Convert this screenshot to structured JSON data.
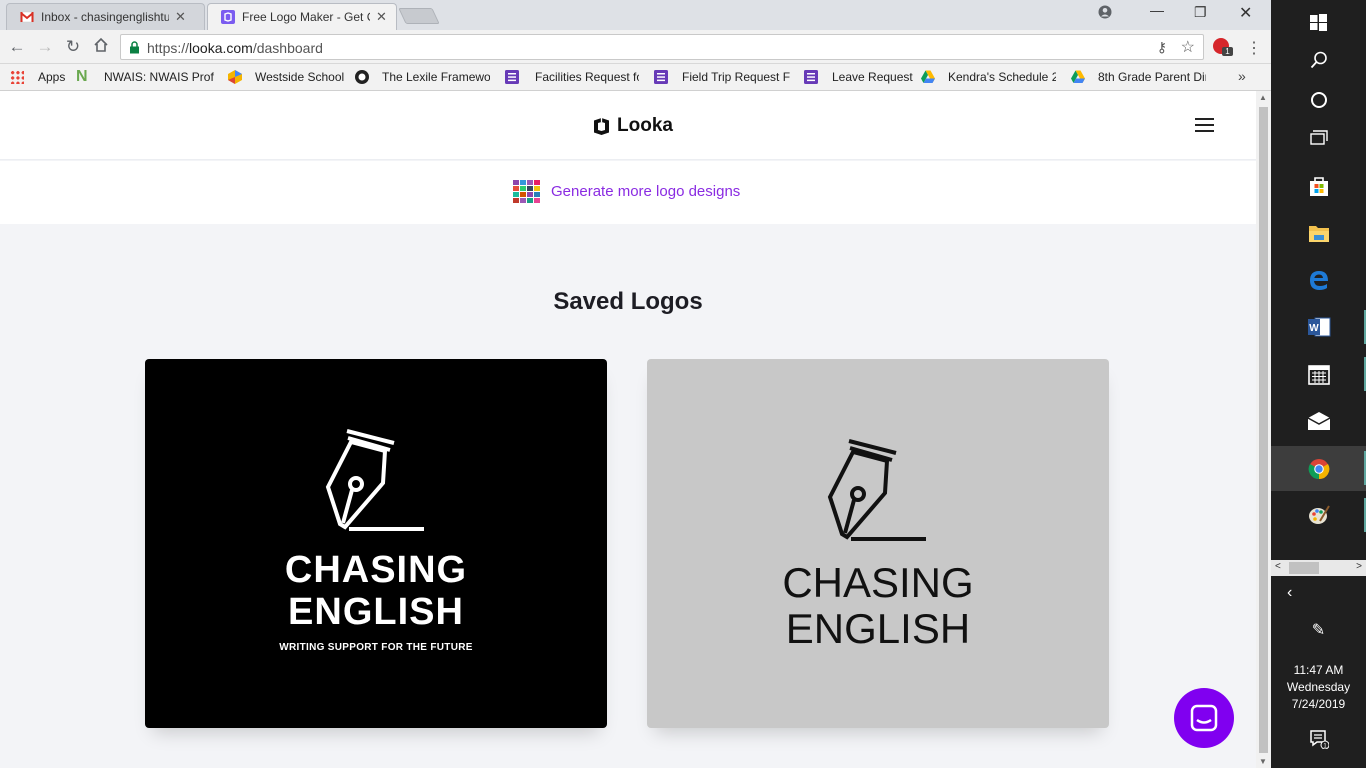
{
  "browser": {
    "tabs": [
      {
        "title": "Inbox - chasingenglishtut",
        "favicon": "gmail-icon"
      },
      {
        "title": "Free Logo Maker - Get Cu",
        "favicon": "looka-icon"
      }
    ],
    "url_scheme": "https://",
    "url_host": "looka.com",
    "url_path": "/dashboard",
    "extension_badge": "1",
    "bookmarks": [
      {
        "label": "Apps",
        "icon": "apps-grid-icon"
      },
      {
        "label": "NWAIS: NWAIS Profe",
        "icon": "nwais-icon"
      },
      {
        "label": "Westside School",
        "icon": "westside-icon"
      },
      {
        "label": "The Lexile Framewor",
        "icon": "lexile-icon"
      },
      {
        "label": "Facilities Request fo",
        "icon": "forms-icon"
      },
      {
        "label": "Field Trip Request Fo",
        "icon": "forms-icon"
      },
      {
        "label": "Leave Request",
        "icon": "forms-icon"
      },
      {
        "label": "Kendra's Schedule 20",
        "icon": "drive-icon"
      },
      {
        "label": "8th Grade Parent Dir",
        "icon": "drive-icon"
      }
    ],
    "more_bookmarks": "»"
  },
  "site": {
    "brand": "Looka",
    "generate_link": "Generate more logo designs",
    "section_title": "Saved Logos",
    "logos": [
      {
        "line1": "CHASING",
        "line2": "ENGLISH",
        "tagline": "WRITING SUPPORT FOR THE FUTURE",
        "background": "#000000",
        "ink": "#ffffff"
      },
      {
        "line1": "CHASING",
        "line2": "ENGLISH",
        "background": "#c8c8c8",
        "ink": "#111111"
      }
    ],
    "accent_color": "#8a2be2",
    "chat_button_color": "#8000f0"
  },
  "taskbar": {
    "items": [
      "windows-start-icon",
      "search-icon",
      "cortana-icon",
      "task-view-icon",
      "store-icon",
      "file-explorer-icon",
      "edge-icon",
      "word-icon",
      "calendar-icon",
      "mail-icon",
      "chrome-icon",
      "paint-icon"
    ],
    "time": "11:47 AM",
    "day": "Wednesday",
    "date": "7/24/2019",
    "notification_count": "1"
  }
}
